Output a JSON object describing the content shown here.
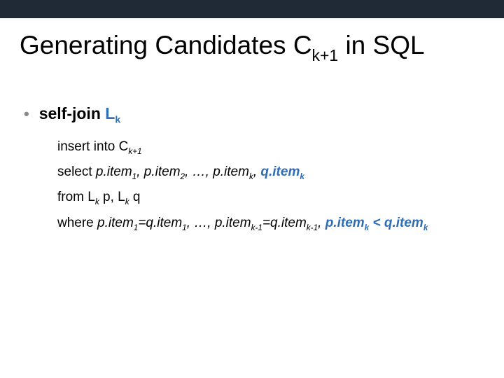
{
  "title": {
    "pre": "Generating Candidates C",
    "sub": "k+1",
    "post": " in SQL"
  },
  "bullet": {
    "dot": "•",
    "pre": "self-join ",
    "L": "L",
    "Lsub": "k"
  },
  "sql": {
    "l1": {
      "a": "insert into C",
      "sub": "k+1"
    },
    "l2": {
      "a": "select ",
      "b": "p.item",
      "bs": "1",
      "c": ", p.item",
      "cs": "2",
      "d": ", …, p.item",
      "ds": "k",
      "e": ", ",
      "f": "q.item",
      "fs": "k"
    },
    "l3": {
      "a": "from L",
      "as": "k",
      "b": " p, L",
      "bs": "k",
      "c": " q"
    },
    "l4": {
      "a": "where ",
      "b": "p.item",
      "bs": "1",
      "c": "=q.item",
      "cs": "1",
      "d": ", …, p.item",
      "ds": "k-1",
      "e": "=q.item",
      "es": "k-1",
      "f": ", ",
      "g": "p.item",
      "gs": "k",
      "h": " < q.item",
      "hs": "k"
    }
  }
}
